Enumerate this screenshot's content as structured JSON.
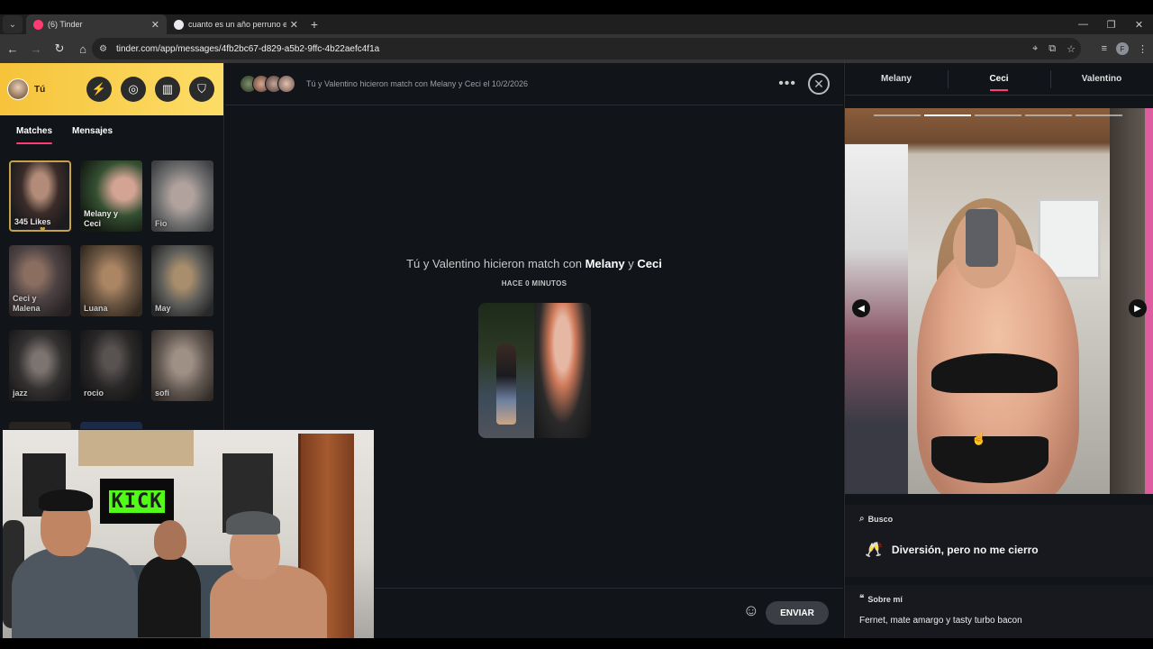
{
  "browser": {
    "tabs": [
      {
        "title": "(6) Tinder",
        "active": true,
        "favicon_color": "#fe3c72"
      },
      {
        "title": "cuanto es un año perruno en h",
        "active": false,
        "favicon_color": "#e8eaed"
      }
    ],
    "new_tab": "+",
    "url": "tinder.com/app/messages/4fb2bc67-d829-a5b2-9ffc-4b22aefc4f1a",
    "profile_initial": "F"
  },
  "sidebar": {
    "me_label": "Tú",
    "tabs": [
      "Matches",
      "Mensajes"
    ],
    "active_tab": "Matches",
    "accent_color": "#fe3c72",
    "header_gradient": [
      "#f6c33a",
      "#fddd67"
    ],
    "cards": [
      {
        "label": "345 Likes",
        "kind": "likes"
      },
      {
        "label": "Melany y Ceci"
      },
      {
        "label": "Fio"
      },
      {
        "label": "Ceci y Malena"
      },
      {
        "label": "Luana"
      },
      {
        "label": "May"
      },
      {
        "label": "jazz"
      },
      {
        "label": "rocio"
      },
      {
        "label": "sofi"
      }
    ]
  },
  "webcam": {
    "screen_text": "KICK",
    "screen_color": "#53fc18"
  },
  "chat": {
    "header_text": "Tú y Valentino hicieron match con Melany y Ceci el 10/2/2026",
    "match_title_prefix": "Tú y Valentino hicieron match con ",
    "match_name_1": "Melany",
    "match_title_mid": " y ",
    "match_name_2": "Ceci",
    "match_time": "HACE 0 MINUTOS",
    "send_label": "ENVIAR"
  },
  "profile": {
    "tabs": [
      "Melany",
      "Ceci",
      "Valentino"
    ],
    "active_tab": "Ceci",
    "photo_count": 5,
    "current_photo": 2,
    "busco_label": "Busco",
    "busco_value": "Diversión, pero no me cierro",
    "sobre_label": "Sobre mí",
    "sobre_value": "Fernet, mate amargo y tasty turbo bacon"
  }
}
